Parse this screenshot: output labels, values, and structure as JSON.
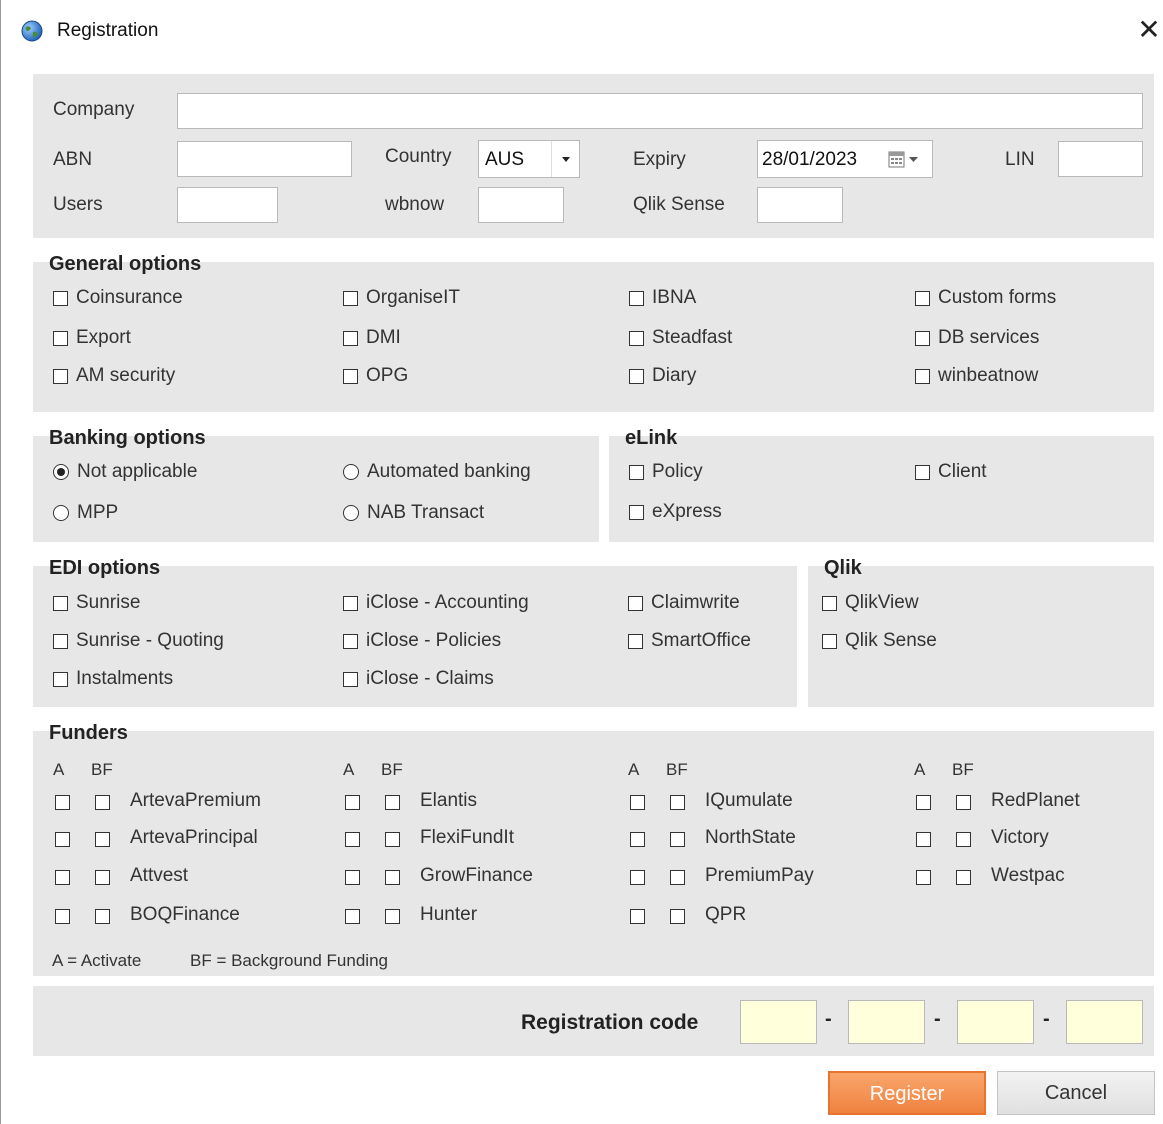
{
  "window": {
    "title": "Registration",
    "close_glyph": "✕",
    "icon": "globe-icon"
  },
  "details": {
    "company_label": "Company",
    "company_value": "",
    "abn_label": "ABN",
    "abn_value": "",
    "country_label": "Country",
    "country_value": "AUS",
    "expiry_label": "Expiry",
    "expiry_value": "28/01/2023",
    "lin_label": "LIN",
    "lin_value": "",
    "users_label": "Users",
    "users_value": "",
    "wbnow_label": "wbnow",
    "wbnow_value": "",
    "qlik_sense_label": "Qlik Sense",
    "qlik_sense_value": ""
  },
  "general_options": {
    "title": "General options",
    "items": [
      "Coinsurance",
      "OrganiseIT",
      "IBNA",
      "Custom forms",
      "Export",
      "DMI",
      "Steadfast",
      "DB services",
      "AM security",
      "OPG",
      "Diary",
      "winbeatnow"
    ]
  },
  "banking_options": {
    "title": "Banking options",
    "items": [
      "Not applicable",
      "Automated banking",
      "MPP",
      "NAB Transact"
    ],
    "selected": "Not applicable"
  },
  "elink": {
    "title": "eLink",
    "items": [
      "Policy",
      "Client",
      "eXpress"
    ]
  },
  "edi_options": {
    "title": "EDI options",
    "items": [
      "Sunrise",
      "iClose - Accounting",
      "Claimwrite",
      "Sunrise - Quoting",
      "iClose - Policies",
      "SmartOffice",
      "Instalments",
      "iClose - Claims"
    ]
  },
  "qlik": {
    "title": "Qlik",
    "items": [
      "QlikView",
      "Qlik Sense"
    ]
  },
  "funders": {
    "title": "Funders",
    "col_a": "A",
    "col_bf": "BF",
    "columns": [
      [
        "ArtevaPremium",
        "ArtevaPrincipal",
        "Attvest",
        "BOQFinance"
      ],
      [
        "Elantis",
        "FlexiFundIt",
        "GrowFinance",
        "Hunter"
      ],
      [
        "IQumulate",
        "NorthState",
        "PremiumPay",
        "QPR"
      ],
      [
        "RedPlanet",
        "Victory",
        "Westpac"
      ]
    ],
    "legend_a": "A = Activate",
    "legend_bf": "BF = Background Funding"
  },
  "registration": {
    "label": "Registration code",
    "separator": "-",
    "codes": [
      "",
      "",
      "",
      ""
    ]
  },
  "buttons": {
    "register": "Register",
    "cancel": "Cancel"
  },
  "colors": {
    "panel": "#e7e7e7",
    "accent": "#f5894a",
    "code_bg": "#ffffdc"
  }
}
